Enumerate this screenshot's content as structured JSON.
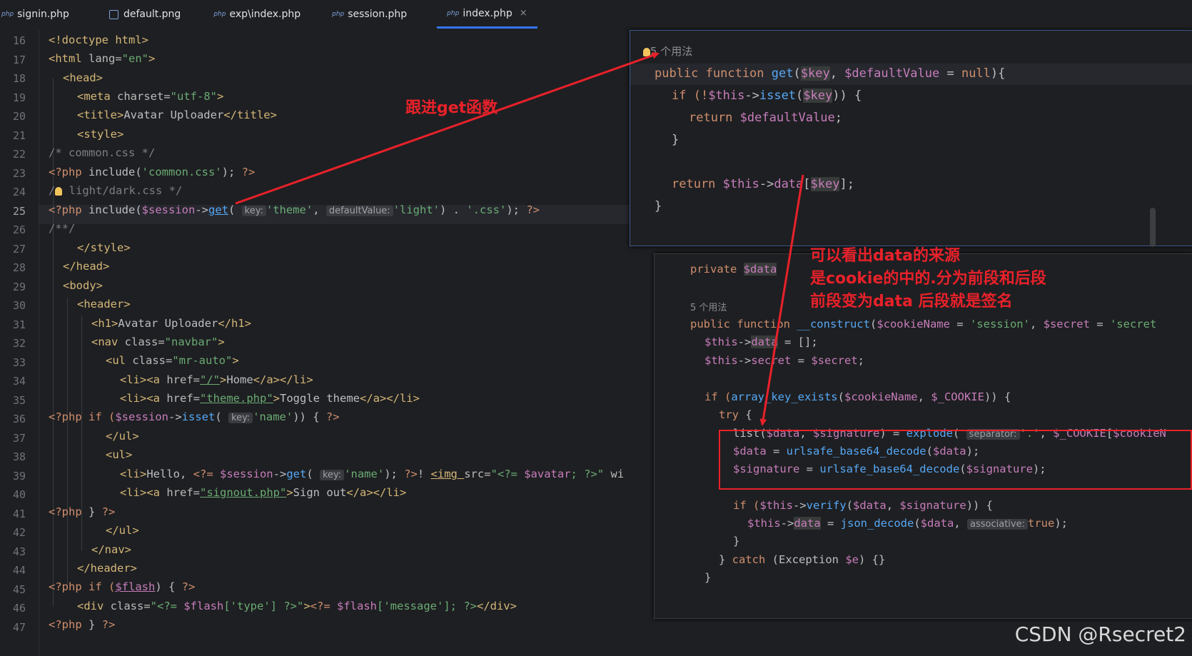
{
  "tabs": [
    {
      "label": "signin.php",
      "icon": "php-file-icon"
    },
    {
      "label": "default.png",
      "icon": "image-file-icon"
    },
    {
      "label": "exp\\index.php",
      "icon": "php-file-icon"
    },
    {
      "label": "session.php",
      "icon": "php-file-icon"
    },
    {
      "label": "index.php",
      "icon": "php-file-icon",
      "active": true
    }
  ],
  "php_icon_text": "php",
  "close_glyph": "×",
  "line_numbers": [
    "16",
    "17",
    "18",
    "19",
    "20",
    "21",
    "22",
    "23",
    "24",
    "25",
    "26",
    "27",
    "28",
    "29",
    "30",
    "31",
    "32",
    "33",
    "34",
    "35",
    "36",
    "37",
    "38",
    "39",
    "40",
    "41",
    "42",
    "43",
    "44",
    "45",
    "46",
    "47"
  ],
  "code": {
    "l16": "<!doctype html>",
    "l17a": "<html ",
    "l17b": "lang=",
    "l17c": "\"en\"",
    "l17d": ">",
    "l18": "<head>",
    "l19a": "<meta ",
    "l19b": "charset=",
    "l19c": "\"utf-8\"",
    "l19d": ">",
    "l20a": "<title>",
    "l20b": "Avatar Uploader",
    "l20c": "</title>",
    "l21": "<style>",
    "l22": "/* common.css */",
    "l23a": "<?php ",
    "l23b": "include(",
    "l23c": "'common.css'",
    "l23d": "); ",
    "l23e": "?>",
    "l24a": "/",
    "l24b": " light/dark.css */",
    "l25a": "<?php ",
    "l25b": "include(",
    "l25c": "$session",
    "l25d": "->",
    "l25e": "get",
    "l25f": "( ",
    "l25g": "key:",
    "l25h": "'theme'",
    "l25i": ", ",
    "l25j": "defaultValue:",
    "l25k": "'light'",
    "l25l": ") . ",
    "l25m": "'.css'",
    "l25n": "); ",
    "l25o": "?>",
    "l26": "/**/",
    "l27": "</style>",
    "l28": "</head>",
    "l29": "<body>",
    "l30": "<header>",
    "l31a": "<h1>",
    "l31b": "Avatar Uploader",
    "l31c": "</h1>",
    "l32a": "<nav ",
    "l32b": "class=",
    "l32c": "\"navbar\"",
    "l32d": ">",
    "l33a": "<ul ",
    "l33b": "class=",
    "l33c": "\"mr-auto\"",
    "l33d": ">",
    "l34a": "<li><a ",
    "l34b": "href=",
    "l34c": "\"/\"",
    "l34d": ">",
    "l34e": "Home",
    "l34f": "</a></li>",
    "l35a": "<li><a ",
    "l35b": "href=",
    "l35c": "\"theme.php\"",
    "l35d": ">",
    "l35e": "Toggle theme",
    "l35f": "</a></li>",
    "l36a": "<?php ",
    "l36b": "if (",
    "l36c": "$session",
    "l36d": "->",
    "l36e": "isset",
    "l36f": "( ",
    "l36g": "key:",
    "l36h": "'name'",
    "l36i": ")) { ",
    "l36j": "?>",
    "l37": "</ul>",
    "l38": "<ul>",
    "l39a": "<li>",
    "l39b": "Hello, ",
    "l39c": "<?= ",
    "l39d": "$session",
    "l39e": "->",
    "l39f": "get",
    "l39g": "( ",
    "l39h": "key:",
    "l39i": "'name'",
    "l39j": "); ",
    "l39k": "?>",
    "l39l": "! ",
    "l39m": "<img ",
    "l39n": "src=",
    "l39o": "\"<?= ",
    "l39p": "$avatar",
    "l39q": "; ?>\"",
    "l39r": " wi",
    "l40a": "<li><a ",
    "l40b": "href=",
    "l40c": "\"signout.php\"",
    "l40d": ">",
    "l40e": "Sign out",
    "l40f": "</a></li>",
    "l41a": "<?php ",
    "l41b": "} ",
    "l41c": "?>",
    "l42": "</ul>",
    "l43": "</nav>",
    "l44": "</header>",
    "l45a": "<?php ",
    "l45b": "if (",
    "l45c": "$flash",
    "l45d": ") { ",
    "l45e": "?>",
    "l46a": "<div ",
    "l46b": "class=",
    "l46c": "\"<?= ",
    "l46d": "$flash",
    "l46e": "['type'] ?>\"",
    "l46f": ">",
    "l46g": "<?= ",
    "l46h": "$flash",
    "l46i": "['message']; ?>",
    "l46j": "</div>",
    "l47a": "<?php ",
    "l47b": "} ",
    "l47c": "?>"
  },
  "popup_get": {
    "usage": "5 个用法",
    "p1a": "public function ",
    "p1b": "get",
    "p1c": "(",
    "p1d": "$key",
    "p1e": ", ",
    "p1f": "$defaultValue",
    "p1g": " = ",
    "p1h": "null",
    "p1i": "){",
    "p2a": "if (!",
    "p2b": "$this",
    "p2c": "->",
    "p2d": "isset",
    "p2e": "(",
    "p2f": "$key",
    "p2g": ")) {",
    "p3a": "return ",
    "p3b": "$defaultValue",
    "p3c": ";",
    "p4": "}",
    "p5a": "return ",
    "p5b": "$this",
    "p5c": "->",
    "p5d": "data",
    "p5e": "[",
    "p5f": "$key",
    "p5g": "];",
    "p6": "}"
  },
  "popup_construct": {
    "q1a": "private ",
    "q1b": "$data",
    "usage": "5 个用法",
    "q2a": "public function ",
    "q2b": "__construct",
    "q2c": "(",
    "q2d": "$cookieName",
    "q2e": " = ",
    "q2f": "'session'",
    "q2g": ", ",
    "q2h": "$secret",
    "q2i": " = ",
    "q2j": "'secret",
    "q3a": "$this",
    "q3b": "->",
    "q3c": "data",
    "q3d": " = [];",
    "q4a": "$this",
    "q4b": "->",
    "q4c": "secret",
    "q4d": " = ",
    "q4e": "$secret",
    "q4f": ";",
    "q5a": "if (",
    "q5b": "array_key_exists",
    "q5c": "(",
    "q5d": "$cookieName",
    "q5e": ", ",
    "q5f": "$_COOKIE",
    "q5g": ")) {",
    "q6a": "try",
    "q6b": " {",
    "q7a": "list(",
    "q7b": "$data",
    "q7c": ", ",
    "q7d": "$signature",
    "q7e": ") = ",
    "q7f": "explode",
    "q7g": "( ",
    "q7h": "separator:",
    "q7i": "'.'",
    "q7j": ", ",
    "q7k": "$_COOKIE",
    "q7l": "[",
    "q7m": "$cookieN",
    "q8a": "$data",
    "q8b": " = ",
    "q8c": "urlsafe_base64_decode",
    "q8d": "(",
    "q8e": "$data",
    "q8f": ");",
    "q9a": "$signature",
    "q9b": " = ",
    "q9c": "urlsafe_base64_decode",
    "q9d": "(",
    "q9e": "$signature",
    "q9f": ");",
    "q10a": "if (",
    "q10b": "$this",
    "q10c": "->",
    "q10d": "verify",
    "q10e": "(",
    "q10f": "$data",
    "q10g": ", ",
    "q10h": "$signature",
    "q10i": ")) {",
    "q11a": "$this",
    "q11b": "->",
    "q11c": "data",
    "q11d": " = ",
    "q11e": "json_decode",
    "q11f": "(",
    "q11g": "$data",
    "q11h": ", ",
    "q11i": "associative:",
    "q11j": "true",
    "q11k": ");",
    "q12": "}",
    "q13a": "} ",
    "q13b": "catch",
    "q13c": " (Exception ",
    "q13d": "$e",
    "q13e": ") {}",
    "q14": "}"
  },
  "annotations": {
    "a1": "跟进get函数",
    "a2": "可以看出data的来源",
    "a3": "是cookie的中的.分为前段和后段",
    "a4": "前段变为data 后段就是签名"
  },
  "watermark": "CSDN @Rsecret2",
  "colors": {
    "annotation": "#e8212a",
    "accent": "#3574f0"
  }
}
